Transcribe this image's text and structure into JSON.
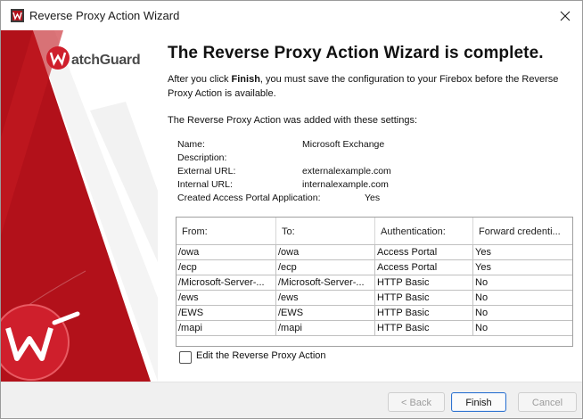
{
  "window": {
    "title": "Reverse Proxy Action Wizard"
  },
  "brand": {
    "logo_text": "WatchGuard",
    "colors": {
      "brand_red": "#b2111a",
      "accent_blue": "#2f74d0"
    }
  },
  "content": {
    "heading": "The Reverse Proxy Action Wizard is complete.",
    "intro_before": "After you click ",
    "intro_bold": "Finish",
    "intro_after": ", you must save the configuration to your Firebox before the Reverse Proxy Action is available.",
    "added_text": "The Reverse Proxy Action was added with these settings:"
  },
  "settings": [
    {
      "label": "Name:",
      "value": "Microsoft Exchange"
    },
    {
      "label": "Description:",
      "value": ""
    },
    {
      "label": "External URL:",
      "value": "externalexample.com"
    },
    {
      "label": "Internal URL:",
      "value": "internalexample.com"
    },
    {
      "label": "Created Access Portal Application:",
      "value": "Yes"
    }
  ],
  "table": {
    "columns": [
      "From:",
      "To:",
      "Authentication:",
      "Forward credenti..."
    ],
    "rows": [
      [
        "/owa",
        "/owa",
        "Access Portal",
        "Yes"
      ],
      [
        "/ecp",
        "/ecp",
        "Access Portal",
        "Yes"
      ],
      [
        "/Microsoft-Server-...",
        "/Microsoft-Server-...",
        "HTTP Basic",
        "No"
      ],
      [
        "/ews",
        "/ews",
        "HTTP Basic",
        "No"
      ],
      [
        "/EWS",
        "/EWS",
        "HTTP Basic",
        "No"
      ],
      [
        "/mapi",
        "/mapi",
        "HTTP Basic",
        "No"
      ]
    ]
  },
  "edit_checkbox": {
    "label": "Edit the Reverse Proxy Action",
    "checked": false
  },
  "buttons": {
    "back": "< Back",
    "finish": "Finish",
    "cancel": "Cancel"
  },
  "icons": {
    "app": "watchguard-app-icon",
    "close": "close-icon",
    "logo": "watchguard-w-logo-icon"
  }
}
